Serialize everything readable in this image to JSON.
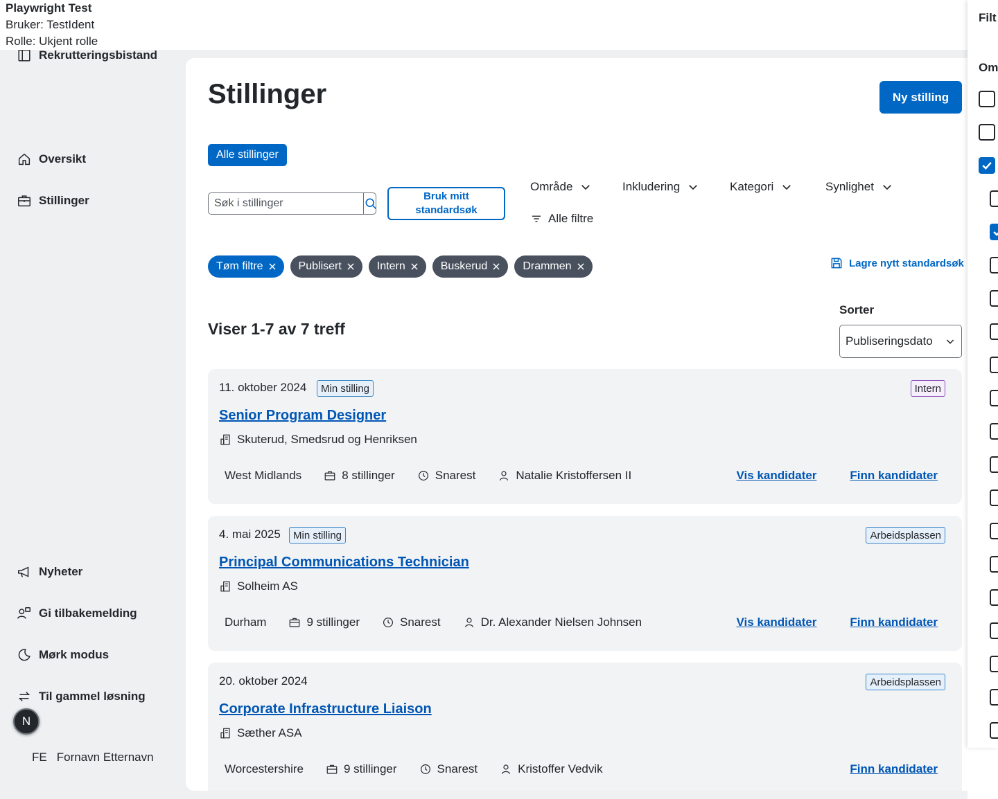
{
  "testbar": {
    "title": "Playwright Test",
    "user": "Bruker: TestIdent",
    "role": "Rolle: Ukjent rolle"
  },
  "sidebar": {
    "brand": "Rekrutteringsbistand",
    "items": [
      {
        "label": "Oversikt",
        "icon": "home-icon"
      },
      {
        "label": "Stillinger",
        "icon": "briefcase-icon"
      },
      {
        "label": "Nyheter",
        "icon": "megaphone-icon"
      },
      {
        "label": "Gi tilbakemelding",
        "icon": "feedback-icon"
      },
      {
        "label": "Mørk modus",
        "icon": "moon-icon"
      },
      {
        "label": "Til gammel løsning",
        "icon": "swap-icon"
      }
    ],
    "avatar_letter": "N",
    "user_initials": "FE",
    "user_name": "Fornavn Etternavn"
  },
  "main": {
    "title": "Stillinger",
    "new_button": "Ny stilling",
    "tab_all": "Alle stillinger",
    "search_placeholder": "Søk i stillinger",
    "std_search_button": "Bruk mitt standardsøk",
    "filters": [
      "Område",
      "Inkludering",
      "Kategori",
      "Synlighet"
    ],
    "all_filters": "Alle filtre",
    "chips": [
      "Tøm filtre",
      "Publisert",
      "Intern",
      "Buskerud",
      "Drammen"
    ],
    "save_std": "Lagre nytt standardsøk",
    "result_count": "Viser 1-7 av 7 treff",
    "sort_label": "Sorter",
    "sort_value": "Publiseringsdato"
  },
  "results": [
    {
      "date": "11. oktober 2024",
      "own_tag": "Min stilling",
      "source_tag": "Intern",
      "title": "Senior Program Designer",
      "employer": "Skuterud, Smedsrud og Henriksen",
      "location": "West Midlands",
      "positions": "8 stillinger",
      "deadline": "Snarest",
      "owner": "Natalie Kristoffersen II",
      "link_view": "Vis kandidater",
      "link_find": "Finn kandidater"
    },
    {
      "date": "4. mai 2025",
      "own_tag": "Min stilling",
      "source_tag": "Arbeidsplassen",
      "title": "Principal Communications Technician",
      "employer": "Solheim AS",
      "location": "Durham",
      "positions": "9 stillinger",
      "deadline": "Snarest",
      "owner": "Dr. Alexander Nielsen Johnsen",
      "link_view": "Vis kandidater",
      "link_find": "Finn kandidater"
    },
    {
      "date": "20. oktober 2024",
      "source_tag": "Arbeidsplassen",
      "title": "Corporate Infrastructure Liaison",
      "employer": "Sæther ASA",
      "location": "Worcestershire",
      "positions": "9 stillinger",
      "deadline": "Snarest",
      "owner": "Kristoffer Vedvik",
      "link_find": "Finn kandidater"
    }
  ],
  "filter_panel": {
    "title": "Filt",
    "section": "Omr"
  },
  "colors": {
    "primary": "#0067c5",
    "link": "#0056b4",
    "chip_neutral": "#49515e",
    "app_bg": "#eef0f2",
    "card_bg": "#f2f3f5"
  }
}
